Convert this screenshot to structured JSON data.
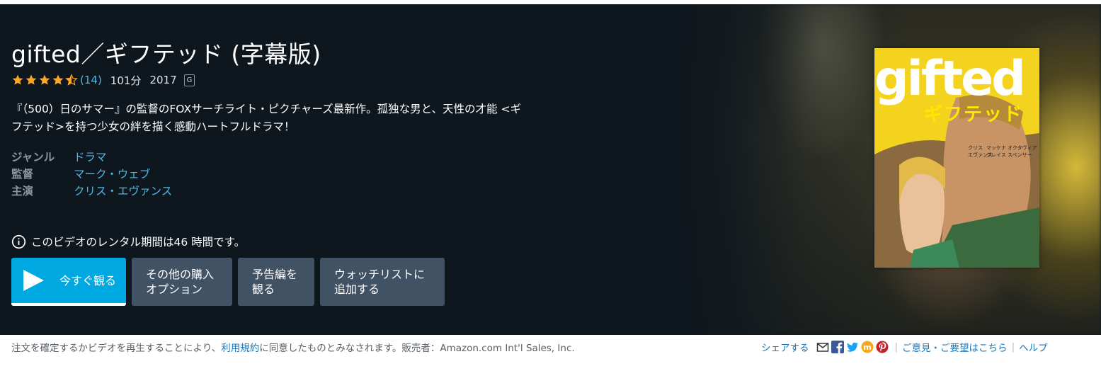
{
  "title": "gifted／ギフテッド (字幕版)",
  "rating": {
    "stars": 4.5,
    "review_count": "(14)"
  },
  "runtime": "101分",
  "year": "2017",
  "content_rating": "G",
  "synopsis_line1": "『（500）日のサマー』の監督のFOXサーチライト・ピクチャーズ最新作。孤独な男と、天性の才能 <ギ",
  "synopsis_line2": "フテッド>を持つ少女の絆を描く感動ハートフルドラマ！",
  "details": {
    "genre_label": "ジャンル",
    "genre": "ドラマ",
    "director_label": "監督",
    "director": "マーク・ウェブ",
    "cast_label": "主演",
    "cast": "クリス・エヴァンス"
  },
  "rental_notice": "このビデオのレンタル期間は46 時間です。",
  "buttons": {
    "play": "今すぐ観る",
    "other_line1": "その他の購入",
    "other_line2": "オプション",
    "trailer_line1": "予告編を",
    "trailer_line2": "観る",
    "watchlist_line1": "ウォッチリストに",
    "watchlist_line2": "追加する"
  },
  "poster": {
    "title_text": "gifted",
    "subtitle_text": "ギフテッド",
    "credits": [
      "クリス",
      "マッケナ",
      "オクタヴィア"
    ],
    "credits2": [
      "エヴァンス",
      "グレイス",
      "スペンサー"
    ]
  },
  "footer": {
    "legal_pre": "注文を確定するかビデオを再生することにより、",
    "legal_link": "利用規約",
    "legal_post": "に同意したものとみなされます。販売者：Amazon.com Int'l Sales, Inc.",
    "share": "シェアする",
    "feedback": "ご意見・ご要望はこちら",
    "help": "ヘルプ"
  },
  "colors": {
    "accent": "#00a8e1",
    "button": "#425265",
    "background": "#0f171e",
    "link": "#4cb8e8",
    "star": "#ffa724"
  }
}
